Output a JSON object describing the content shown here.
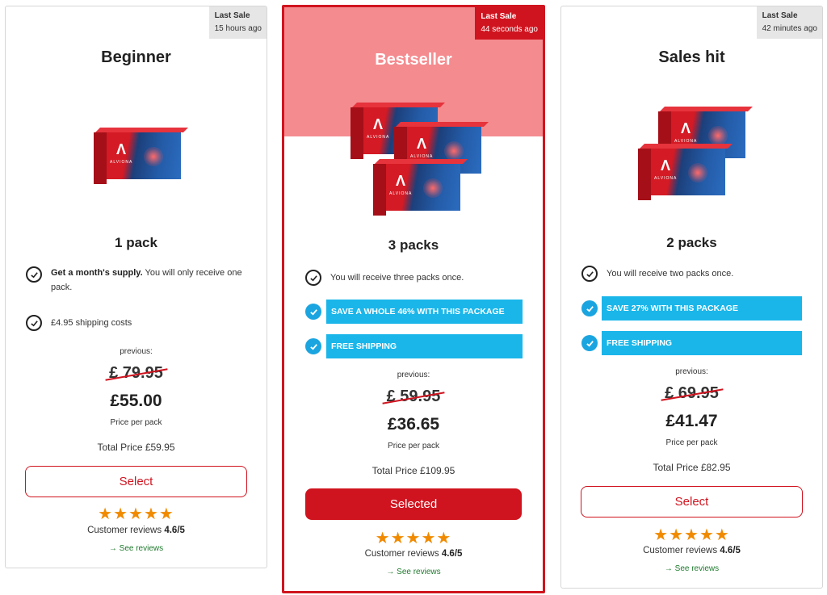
{
  "colors": {
    "accent_red": "#d0141f",
    "promo_blue": "#1ab6ea",
    "pink_band": "#f48b8f",
    "star_orange": "#f08a00",
    "link_green": "#1f7a2e"
  },
  "icons": {
    "check": "check-icon",
    "star": "star-icon",
    "arrow": "arrow-right-icon"
  },
  "cards": [
    {
      "last_sale_label": "Last Sale",
      "last_sale_time": "15 hours ago",
      "title": "Beginner",
      "pack_count": "1 pack",
      "features": [
        {
          "bold": "Get a month's supply.",
          "text": " You will only receive one pack."
        },
        {
          "bold": "",
          "text": "£4.95 shipping costs"
        }
      ],
      "promos": [],
      "previous_label": "previous:",
      "old_price": "£ 79.95",
      "price": "£55.00",
      "per_pack_label": "Price per pack",
      "total_price": "Total Price £59.95",
      "button_label": "Select",
      "reviews_label": "Customer reviews",
      "rating": "4.6/5",
      "see_reviews": "See reviews"
    },
    {
      "last_sale_label": "Last Sale",
      "last_sale_time": "44 seconds ago",
      "title": "Bestseller",
      "pack_count": "3 packs",
      "features": [
        {
          "bold": "",
          "text": "You will receive three packs once."
        }
      ],
      "promos": [
        "SAVE A WHOLE 46% WITH THIS PACKAGE",
        "FREE SHIPPING"
      ],
      "previous_label": "previous:",
      "old_price": "£ 59.95",
      "price": "£36.65",
      "per_pack_label": "Price per pack",
      "total_price": "Total Price £109.95",
      "button_label": "Selected",
      "reviews_label": "Customer reviews",
      "rating": "4.6/5",
      "see_reviews": "See reviews"
    },
    {
      "last_sale_label": "Last Sale",
      "last_sale_time": "42 minutes ago",
      "title": "Sales hit",
      "pack_count": "2 packs",
      "features": [
        {
          "bold": "",
          "text": "You will receive two packs once."
        }
      ],
      "promos": [
        "SAVE 27% WITH THIS PACKAGE",
        "FREE SHIPPING"
      ],
      "previous_label": "previous:",
      "old_price": "£ 69.95",
      "price": "£41.47",
      "per_pack_label": "Price per pack",
      "total_price": "Total Price £82.95",
      "button_label": "Select",
      "reviews_label": "Customer reviews",
      "rating": "4.6/5",
      "see_reviews": "See reviews"
    }
  ],
  "product_brand": "ALVIONA"
}
